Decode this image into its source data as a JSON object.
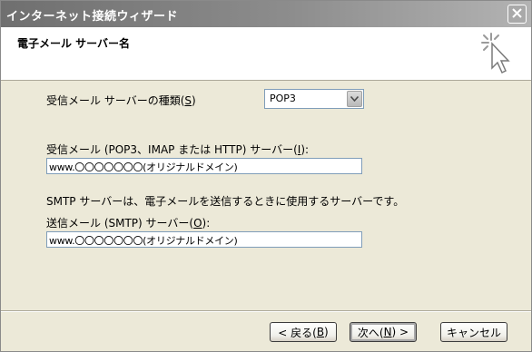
{
  "window": {
    "title": "インターネット接続ウィザード",
    "heading": "電子メール サーバー名"
  },
  "form": {
    "server_type_label_pre": "受信メール サーバーの種類(",
    "server_type_label_key": "S",
    "server_type_label_post": ")",
    "server_type_value": "POP3",
    "incoming_label_pre": "受信メール (POP3、IMAP または HTTP) サーバー(",
    "incoming_label_key": "I",
    "incoming_label_post": "):",
    "incoming_value": "www.〇〇〇〇〇〇〇(オリジナルドメイン)",
    "smtp_note": "SMTP サーバーは、電子メールを送信するときに使用するサーバーです。",
    "outgoing_label_pre": "送信メール (SMTP) サーバー(",
    "outgoing_label_key": "O",
    "outgoing_label_post": "):",
    "outgoing_value": "www.〇〇〇〇〇〇〇(オリジナルドメイン)"
  },
  "buttons": {
    "back_pre": "< 戻る(",
    "back_key": "B",
    "back_post": ")",
    "next_pre": "次へ(",
    "next_key": "N",
    "next_post": ") >",
    "cancel": "キャンセル"
  },
  "icons": {
    "close": "close-icon",
    "wizard": "wizard-cursor-icon",
    "dropdown": "chevron-down-icon"
  },
  "colors": {
    "titlebar": "#8d8d8d",
    "dialog_bg": "#ece9d8",
    "input_border": "#7f9db9"
  }
}
